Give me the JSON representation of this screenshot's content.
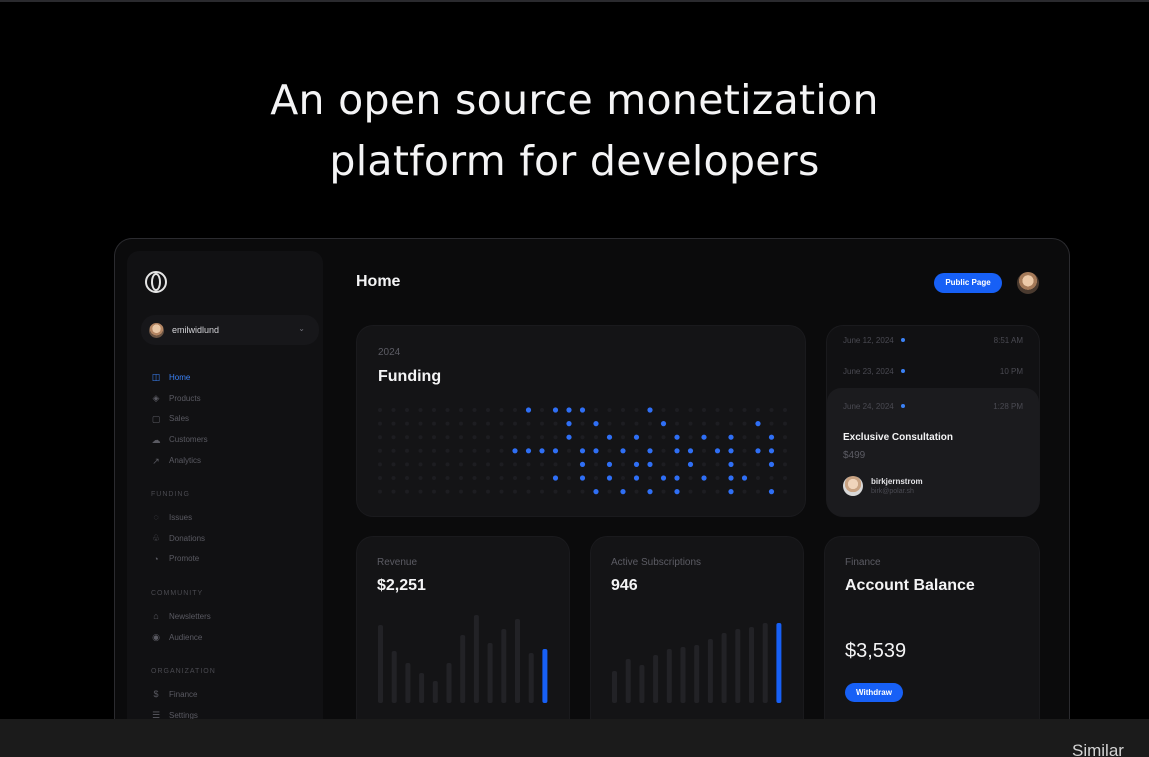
{
  "hero": {
    "line1": "An open source monetization",
    "line2": "platform for developers"
  },
  "sidebar": {
    "account": "emilwidlund",
    "main_items": [
      {
        "label": "Home",
        "icon": "home-icon",
        "active": true
      },
      {
        "label": "Products",
        "icon": "box-icon",
        "active": false
      },
      {
        "label": "Sales",
        "icon": "bag-icon",
        "active": false
      },
      {
        "label": "Customers",
        "icon": "users-icon",
        "active": false
      },
      {
        "label": "Analytics",
        "icon": "trend-icon",
        "active": false
      }
    ],
    "funding_heading": "FUNDING",
    "funding_items": [
      {
        "label": "Issues",
        "icon": "issue-icon"
      },
      {
        "label": "Donations",
        "icon": "donation-icon"
      },
      {
        "label": "Promote",
        "icon": "promote-icon"
      }
    ],
    "community_heading": "COMMUNITY",
    "community_items": [
      {
        "label": "Newsletters",
        "icon": "mail-icon"
      },
      {
        "label": "Audience",
        "icon": "audience-icon"
      }
    ],
    "organization_heading": "ORGANIZATION",
    "organization_items": [
      {
        "label": "Finance",
        "icon": "dollar-icon"
      },
      {
        "label": "Settings",
        "icon": "settings-icon"
      }
    ]
  },
  "header": {
    "title": "Home",
    "public_page": "Public Page"
  },
  "funding_card": {
    "year": "2024",
    "title": "Funding"
  },
  "events": {
    "rows": [
      {
        "date": "June 12, 2024",
        "time": "8:51 AM"
      },
      {
        "date": "June 23, 2024",
        "time": "10 PM"
      }
    ],
    "active": {
      "date": "June 24, 2024",
      "time": "1:28 PM",
      "title": "Exclusive Consultation",
      "price": "$499",
      "user": "birkjernstrom",
      "email": "birk@polar.sh"
    }
  },
  "revenue": {
    "label": "Revenue",
    "value": "$2,251"
  },
  "subscriptions": {
    "label": "Active Subscriptions",
    "value": "946"
  },
  "finance": {
    "label": "Finance",
    "title": "Account Balance",
    "balance": "$3,539",
    "withdraw": "Withdraw"
  },
  "footer": {
    "similar": "Similar"
  },
  "colors": {
    "accent": "#1760f6",
    "dot_active": "#2f6ff5",
    "dot_inactive": "#1d1d21"
  }
}
